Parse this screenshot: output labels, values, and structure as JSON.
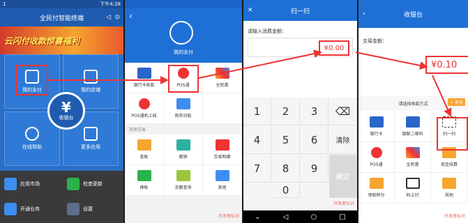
{
  "panel1": {
    "status_left": "1",
    "status_right": "下午4:28",
    "title": "全民付智能终端",
    "banner": "云闪付收款惊喜福利",
    "tiles": [
      "我的支付",
      "我的店铺",
      "在线帮助",
      "更多应用"
    ],
    "center_label": "收银台",
    "center_symbol": "¥",
    "bottom_items": [
      "应用市场",
      "检查更新",
      "开通业务",
      "设置"
    ]
  },
  "panel2": {
    "header_label": "我的支付",
    "row1": [
      "银行卡收款",
      "POS通",
      "全民惠"
    ],
    "row2": [
      "POS通机上线",
      "商务功能",
      ""
    ],
    "section": "其他交易",
    "row3": [
      "查账",
      "撤销",
      "交易明细"
    ],
    "row4": [
      "换帐",
      "余额查询",
      "其他"
    ],
    "watermark": "开发者标识"
  },
  "panel3": {
    "title": "扫一扫",
    "label": "请输入消费金额：",
    "amount": "¥0.00",
    "keys": [
      "1",
      "2",
      "3",
      "⌫",
      "4",
      "5",
      "6",
      "清除",
      "7",
      "8",
      "9",
      "确定",
      "0"
    ],
    "watermark": "开发者标识"
  },
  "panel4": {
    "title": "收银台",
    "label": "交易金额：",
    "amount": "¥0.10",
    "pay_label": "请选择收款方式",
    "pay_badge": "+ 更多",
    "row1": [
      "银行卡",
      "银联二维码",
      "扫一扫"
    ],
    "row2": [
      "POS通",
      "全民惠",
      "现金结算"
    ],
    "row3": [
      "领取积分",
      "码上付",
      "其他"
    ],
    "watermark": "开发者标识"
  },
  "colors": {
    "brand_blue": "#1f70d6",
    "highlight": "#e33333",
    "orange": "#f6a531"
  }
}
